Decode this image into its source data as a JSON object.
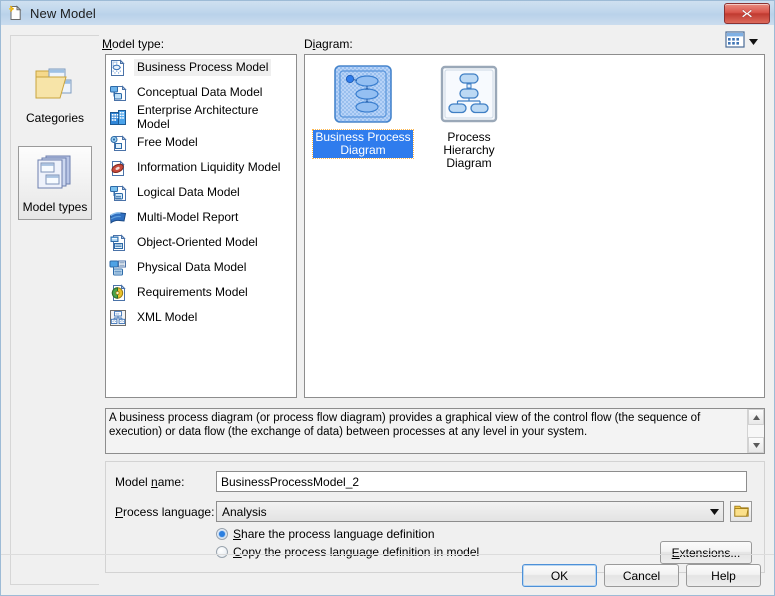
{
  "window": {
    "title": "New Model",
    "title_icon": "new-document-icon",
    "close_label": "x"
  },
  "sidebar": {
    "items": [
      {
        "label": "Categories",
        "icon": "folder-documents-icon",
        "selected": false
      },
      {
        "label": "Model types",
        "icon": "stacked-windows-icon",
        "selected": true
      }
    ]
  },
  "labels": {
    "model_type": "Model type:",
    "model_type_accel": "M",
    "diagram": "Diagram:",
    "diagram_accel": "i",
    "model_name": "Model name:",
    "model_name_accel": "n",
    "process_language": "Process language:",
    "process_language_accel": "P"
  },
  "model_types": [
    {
      "label": "Business Process Model",
      "icon": "business-process-model-icon",
      "selected": true
    },
    {
      "label": "Conceptual Data Model",
      "icon": "conceptual-data-model-icon",
      "selected": false
    },
    {
      "label": "Enterprise Architecture Model",
      "icon": "enterprise-architecture-model-icon",
      "selected": false
    },
    {
      "label": "Free Model",
      "icon": "free-model-icon",
      "selected": false
    },
    {
      "label": "Information Liquidity Model",
      "icon": "information-liquidity-model-icon",
      "selected": false
    },
    {
      "label": "Logical Data Model",
      "icon": "logical-data-model-icon",
      "selected": false
    },
    {
      "label": "Multi-Model Report",
      "icon": "multi-model-report-icon",
      "selected": false
    },
    {
      "label": "Object-Oriented Model",
      "icon": "object-oriented-model-icon",
      "selected": false
    },
    {
      "label": "Physical Data Model",
      "icon": "physical-data-model-icon",
      "selected": false
    },
    {
      "label": "Requirements Model",
      "icon": "requirements-model-icon",
      "selected": false
    },
    {
      "label": "XML Model",
      "icon": "xml-model-icon",
      "selected": false
    }
  ],
  "diagrams": [
    {
      "label_line1": "Business Process",
      "label_line2": "Diagram",
      "icon": "business-process-diagram-thumbnail",
      "selected": true
    },
    {
      "label_line1": "Process Hierarchy",
      "label_line2": "Diagram",
      "icon": "process-hierarchy-diagram-thumbnail",
      "selected": false
    }
  ],
  "view_mode": {
    "icon": "list-view-icon",
    "dropdown_icon": "chevron-down-icon"
  },
  "description": {
    "text": "A business process diagram (or process flow diagram) provides a graphical view of the control flow (the sequence of execution) or data flow (the exchange of data) between processes at any level in your system.",
    "scroll_up_icon": "scroll-up-arrow-icon",
    "scroll_down_icon": "scroll-down-arrow-icon"
  },
  "form": {
    "model_name_value": "BusinessProcessModel_2",
    "process_language_value": "Analysis",
    "process_language_dropdown_icon": "chevron-down-icon",
    "browse_icon": "folder-icon",
    "radio_share": "Share the process language definition",
    "radio_share_accel": "S",
    "radio_copy": "Copy the process language definition in model",
    "radio_copy_accel": "C",
    "radio_selected": "share",
    "extensions_label": "Extensions...",
    "extensions_accel": "E"
  },
  "footer": {
    "ok_label": "OK",
    "cancel_label": "Cancel",
    "help_label": "Help"
  },
  "colors": {
    "accent": "#2f7ced",
    "titlebar": "#bfd6ec",
    "dialog_bg": "#f0f0f0",
    "close_red": "#c03a30"
  }
}
